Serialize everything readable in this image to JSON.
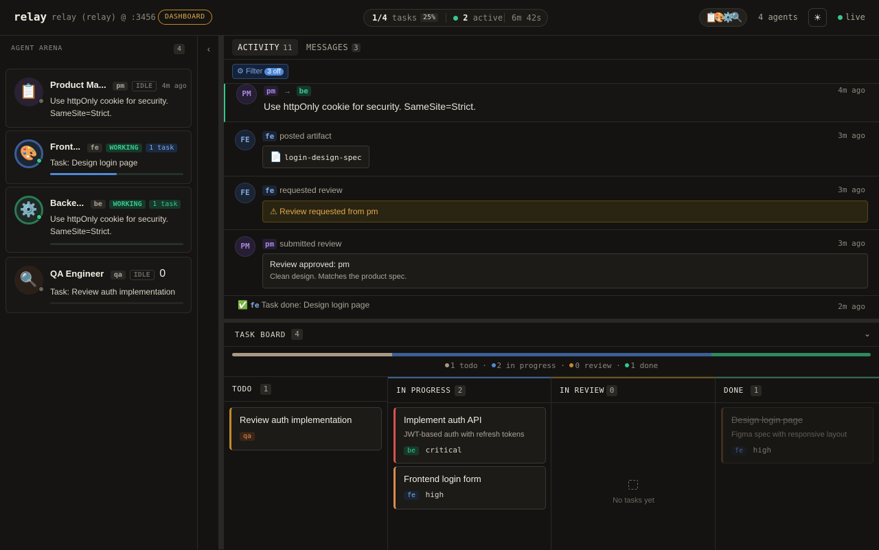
{
  "header": {
    "logo": "relay",
    "project": "relay (relay) @ :3456",
    "badge": "DASHBOARD",
    "tasks_fraction": "1/4",
    "tasks_word": "tasks",
    "tasks_pct": "25%",
    "active_count": "2",
    "active_word": "active",
    "elapsed": "6m 42s",
    "agent_avatars": "📋🎨⚙️🔍",
    "agents_count": "4 agents",
    "theme_icon": "☀",
    "live": "live"
  },
  "sidebar": {
    "title": "AGENT ARENA",
    "count": "4",
    "agents": [
      {
        "emoji": "📋",
        "name": "Product Ma...",
        "role": "pm",
        "status": "IDLE",
        "meta": "4m ago",
        "desc": "Use httpOnly cookie for security. SameSite=Strict.",
        "status_color": "#6b675f"
      },
      {
        "emoji": "🎨",
        "name": "Front...",
        "role": "fe",
        "status": "WORKING",
        "meta": "1 task",
        "desc": "Task: Design login page",
        "status_color": "#35c98a",
        "progress": 0.5
      },
      {
        "emoji": "⚙️",
        "name": "Backe...",
        "role": "be",
        "status": "WORKING",
        "meta": "1 task",
        "desc": "Use httpOnly cookie for security. SameSite=Strict.",
        "status_color": "#35c98a",
        "progress": 0
      },
      {
        "emoji": "🔍",
        "name": "QA Engineer",
        "role": "qa",
        "status": "IDLE",
        "meta": "0",
        "desc": "Task: Review auth implementation",
        "status_color": "#6b675f",
        "progress": 0
      }
    ]
  },
  "tabs": [
    {
      "label": "ACTIVITY",
      "count": "11"
    },
    {
      "label": "MESSAGES",
      "count": "3"
    }
  ],
  "filter": {
    "label": "Filter",
    "off": "3 off",
    "icon": "gear-icon"
  },
  "feed": {
    "msg": {
      "avatar": "PM",
      "from": "pm",
      "arrow": "→",
      "to": "be",
      "text": "Use httpOnly cookie for security. SameSite=Strict.",
      "time": "4m ago"
    },
    "artifact": {
      "avatar": "FE",
      "who": "fe",
      "action": "posted artifact",
      "file": "login-design-spec",
      "time": "3m ago"
    },
    "review_req": {
      "avatar": "FE",
      "who": "fe",
      "action": "requested review",
      "text": "Review requested from pm",
      "time": "3m ago"
    },
    "review_sub": {
      "avatar": "PM",
      "who": "pm",
      "action": "submitted review",
      "title": "Review approved: pm",
      "body": "Clean design. Matches the product spec.",
      "time": "3m ago"
    },
    "done": {
      "who": "fe",
      "text": "Task done: Design login page",
      "time": "2m ago"
    }
  },
  "board": {
    "title": "TASK BOARD",
    "count": "4",
    "progress": {
      "done": 0.25,
      "in_progress": 0.5,
      "todo": 0.25
    },
    "legend": {
      "todo": "1 todo",
      "in_progress": "2 in progress",
      "review": "0 review",
      "done": "1 done"
    },
    "columns": [
      {
        "title": "TODO",
        "count": "1"
      },
      {
        "title": "IN PROGRESS",
        "count": "2"
      },
      {
        "title": "IN REVIEW",
        "count": "0",
        "empty": "No tasks yet"
      },
      {
        "title": "DONE",
        "count": "1"
      }
    ],
    "tasks": {
      "todo1": {
        "title": "Review auth implementation",
        "tag": "qa"
      },
      "ip1": {
        "title": "Implement auth API",
        "desc": "JWT-based auth with refresh tokens",
        "tag": "be",
        "priority": "critical"
      },
      "ip2": {
        "title": "Frontend login form",
        "tag": "fe",
        "priority": "high"
      },
      "done1": {
        "title": "Design login page",
        "desc": "Figma spec with responsive layout",
        "tag": "fe",
        "priority": "high"
      }
    }
  },
  "colors": {
    "accent": "#4f89d9",
    "green": "#35c98a",
    "amber": "#e0a94a",
    "purple": "#a986e0",
    "red": "#d9534f"
  }
}
